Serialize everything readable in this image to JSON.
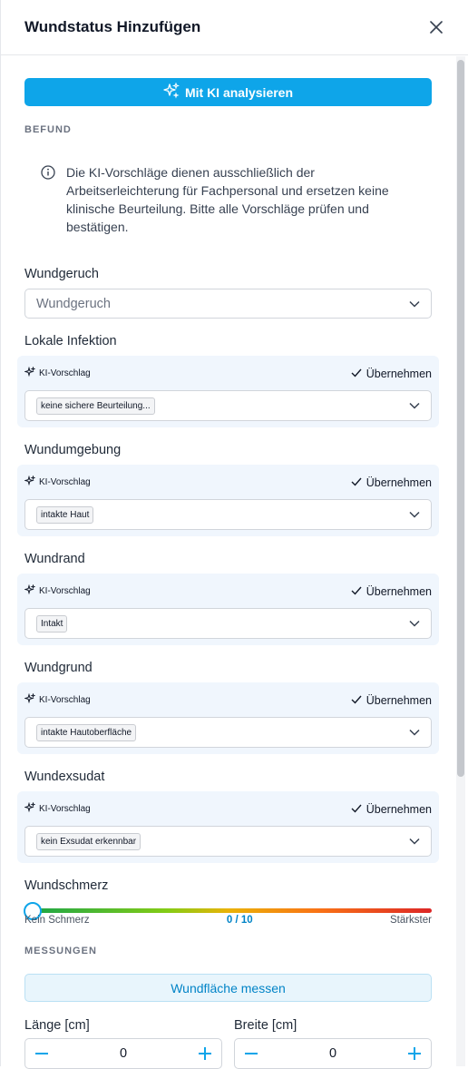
{
  "header": {
    "title": "Wundstatus Hinzufügen"
  },
  "ai_button": {
    "label": "Mit KI analysieren"
  },
  "sections": {
    "befund": "BEFUND",
    "messungen": "MESSUNGEN"
  },
  "notice": {
    "text": "Die KI-Vorschläge dienen ausschließlich der Arbeitserleichterung für Fachpersonal und ersetzen keine klinische Beurteilung. Bitte alle Vorschläge prüfen und bestätigen."
  },
  "wundgeruch": {
    "label": "Wundgeruch",
    "placeholder": "Wundgeruch"
  },
  "ai_fields": [
    {
      "label": "Lokale Infektion",
      "tag": "KI-Vorschlag",
      "apply": "Übernehmen",
      "value": "keine sichere Beurteilung..."
    },
    {
      "label": "Wundumgebung",
      "tag": "KI-Vorschlag",
      "apply": "Übernehmen",
      "value": "intakte Haut"
    },
    {
      "label": "Wundrand",
      "tag": "KI-Vorschlag",
      "apply": "Übernehmen",
      "value": "Intakt"
    },
    {
      "label": "Wundgrund",
      "tag": "KI-Vorschlag",
      "apply": "Übernehmen",
      "value": "intakte Hautoberfläche"
    },
    {
      "label": "Wundexsudat",
      "tag": "KI-Vorschlag",
      "apply": "Übernehmen",
      "value": "kein Exsudat erkennbar"
    }
  ],
  "wundschmerz": {
    "label": "Wundschmerz",
    "min_label": "Kein Schmerz",
    "value_label": "0 / 10",
    "max_label": "Stärkster",
    "value": 0,
    "max": 10
  },
  "measure_button": {
    "label": "Wundfläche messen"
  },
  "laenge": {
    "label": "Länge [cm]",
    "value": "0"
  },
  "breite": {
    "label": "Breite [cm]",
    "value": "0"
  },
  "colors": {
    "accent": "#0ea5e9",
    "ai_box_bg": "#f0f6fd"
  }
}
